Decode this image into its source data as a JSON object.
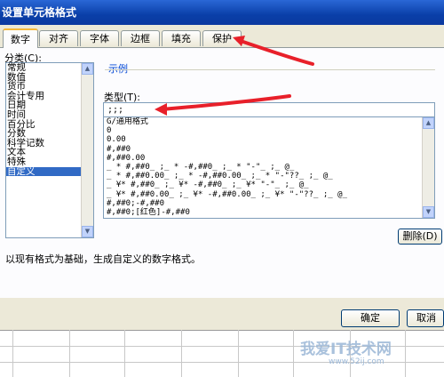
{
  "window": {
    "title": "设置单元格格式"
  },
  "tabs": [
    {
      "label": "数字",
      "active": true
    },
    {
      "label": "对齐",
      "active": false
    },
    {
      "label": "字体",
      "active": false
    },
    {
      "label": "边框",
      "active": false
    },
    {
      "label": "填充",
      "active": false
    },
    {
      "label": "保护",
      "active": false
    }
  ],
  "category": {
    "label": "分类(C):",
    "items": [
      "常规",
      "数值",
      "货币",
      "会计专用",
      "日期",
      "时间",
      "百分比",
      "分数",
      "科学记数",
      "文本",
      "特殊",
      "自定义"
    ],
    "selected": "自定义"
  },
  "sample": {
    "label": "示例"
  },
  "type": {
    "label": "类型(T):",
    "value": ";;;"
  },
  "formats": [
    "G/通用格式",
    "0",
    "0.00",
    "#,##0",
    "#,##0.00",
    "_ * #,##0_ ;_ * -#,##0_ ;_ * \"-\"_ ;_ @_",
    "_ * #,##0.00_ ;_ * -#,##0.00_ ;_ * \"-\"??_ ;_ @_",
    "_ ¥* #,##0_ ;_ ¥* -#,##0_ ;_ ¥* \"-\"_ ;_ @_",
    "_ ¥* #,##0.00_ ;_ ¥* -#,##0.00_ ;_ ¥* \"-\"??_ ;_ @_",
    "#,##0;-#,##0",
    "#,##0;[红色]-#,##0"
  ],
  "buttons": {
    "delete": "删除(D)",
    "ok": "确定",
    "cancel": "取消"
  },
  "hint": "以现有格式为基础，生成自定义的数字格式。",
  "watermark": {
    "text": "我爱IT技术网",
    "url": "www.52ij.com"
  },
  "colors": {
    "titlebar": "#0a3fa8",
    "selection": "#316ac5",
    "arrow": "#e8202a"
  }
}
